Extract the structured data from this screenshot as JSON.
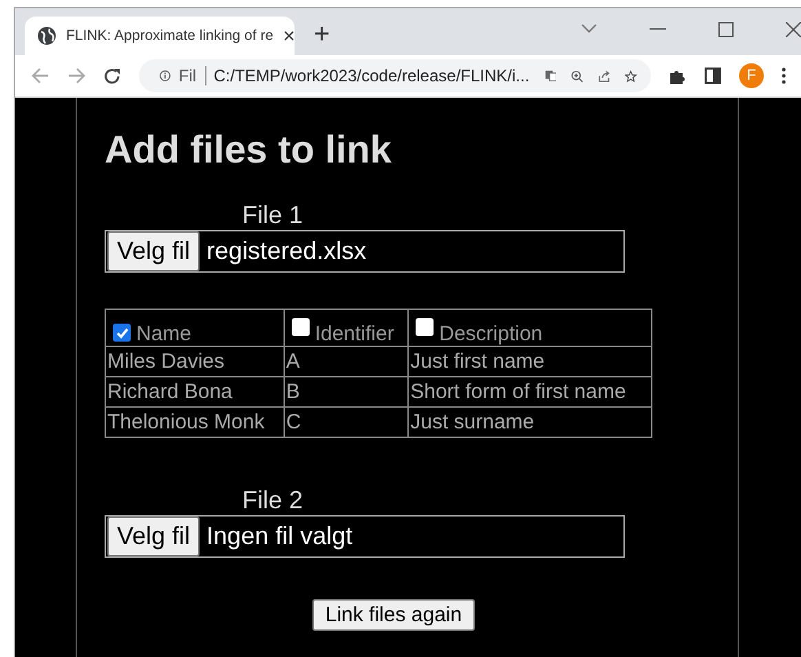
{
  "browser": {
    "tab": {
      "title": "FLINK: Approximate linking of re",
      "close": "×"
    },
    "new_tab": "+",
    "address": {
      "security_label": "Fil",
      "url": "C:/TEMP/work2023/code/release/FLINK/i..."
    },
    "profile_initial": "F"
  },
  "page": {
    "heading": "Add files to link",
    "files": [
      {
        "label": "File 1",
        "button": "Velg fil",
        "filename": "registered.xlsx",
        "table": {
          "columns": [
            {
              "label": "Name",
              "checked": true
            },
            {
              "label": "Identifier",
              "checked": false
            },
            {
              "label": "Description",
              "checked": false
            }
          ],
          "rows": [
            [
              "Miles Davies",
              "A",
              "Just first name"
            ],
            [
              "Richard Bona",
              "B",
              "Short form of first name"
            ],
            [
              "Thelonious Monk",
              "C",
              "Just surname"
            ]
          ]
        }
      },
      {
        "label": "File 2",
        "button": "Velg fil",
        "filename": "Ingen fil valgt"
      }
    ],
    "link_button": "Link files again"
  }
}
